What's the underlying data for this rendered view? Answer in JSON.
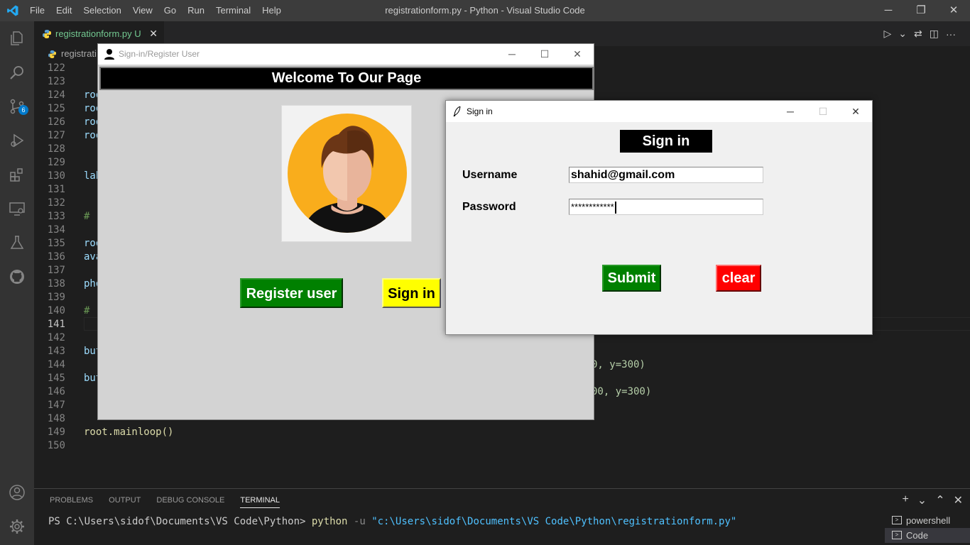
{
  "vscode": {
    "window_title": "registrationform.py - Python - Visual Studio Code",
    "menu": [
      "File",
      "Edit",
      "Selection",
      "View",
      "Go",
      "Run",
      "Terminal",
      "Help"
    ],
    "window_controls": {
      "minimize": "─",
      "restore": "❐",
      "close": "✕"
    },
    "activity_bar": {
      "source_control_badge": "6",
      "icons": [
        "explorer-icon",
        "search-icon",
        "source-control-icon",
        "run-debug-icon",
        "extensions-icon",
        "remote-explorer-icon",
        "testing-icon",
        "github-icon",
        "account-icon",
        "settings-gear-icon"
      ]
    },
    "tab": {
      "label": "registrationform.py",
      "status": "U",
      "close": "✕"
    },
    "breadcrumb": "registrati",
    "editor_actions": {
      "run": "▷",
      "run_menu": "⌄",
      "compare": "⇄",
      "split": "◫",
      "more": "···"
    },
    "code_lines": [
      {
        "n": "122",
        "t": ""
      },
      {
        "n": "123",
        "t": ""
      },
      {
        "n": "124",
        "t": "roo"
      },
      {
        "n": "125",
        "t": "roo"
      },
      {
        "n": "126",
        "t": "roo"
      },
      {
        "n": "127",
        "t": "roo"
      },
      {
        "n": "128",
        "t": ""
      },
      {
        "n": "129",
        "t": ""
      },
      {
        "n": "130",
        "t": "lab"
      },
      {
        "n": "131",
        "t": ""
      },
      {
        "n": "132",
        "t": ""
      },
      {
        "n": "133",
        "t": "# "
      },
      {
        "n": "134",
        "t": ""
      },
      {
        "n": "135",
        "t": "roo"
      },
      {
        "n": "136",
        "t": "ava"
      },
      {
        "n": "137",
        "t": ""
      },
      {
        "n": "138",
        "t": "pho"
      },
      {
        "n": "139",
        "t": ""
      },
      {
        "n": "140",
        "t": "# "
      },
      {
        "n": "141",
        "t": ""
      },
      {
        "n": "142",
        "t": ""
      },
      {
        "n": "143",
        "t": "but"
      },
      {
        "n": "144",
        "t": ""
      },
      {
        "n": "145",
        "t": "but"
      },
      {
        "n": "146",
        "t": ""
      },
      {
        "n": "147",
        "t": ""
      },
      {
        "n": "148",
        "t": ""
      },
      {
        "n": "149",
        "t": "root.mainloop()"
      },
      {
        "n": "150",
        "t": ""
      }
    ],
    "active_line": "141",
    "visible_code_fragments": {
      "line144": "0, y=300)",
      "line146": "00, y=300)"
    },
    "panel": {
      "tabs": [
        "PROBLEMS",
        "OUTPUT",
        "DEBUG CONSOLE",
        "TERMINAL"
      ],
      "active_tab": "TERMINAL",
      "actions": {
        "add": "+",
        "dropdown": "⌄",
        "maximize": "⌃",
        "close": "✕"
      },
      "terminal_prompt": "PS C:\\Users\\sidof\\Documents\\VS Code\\Python>",
      "terminal_command": "python",
      "terminal_flag": "-u",
      "terminal_arg": "\"c:\\Users\\sidof\\Documents\\VS Code\\Python\\registrationform.py\"",
      "terminals": [
        "powershell",
        "Code"
      ]
    }
  },
  "register_window": {
    "title": "Sign-in/Register User",
    "controls": {
      "minimize": "─",
      "maximize": "☐",
      "close": "✕"
    },
    "heading": "Welcome To Our Page",
    "register_button": "Register user",
    "signin_button": "Sign in",
    "colors": {
      "register": "#008000",
      "signin": "#ffff00",
      "background": "#d3d3d3"
    }
  },
  "signin_window": {
    "title": "Sign in",
    "controls": {
      "minimize": "─",
      "maximize": "☐",
      "close": "✕"
    },
    "heading": "Sign in",
    "username_label": "Username",
    "username_value": "shahid@gmail.com",
    "password_label": "Password",
    "password_value": "************",
    "submit_button": "Submit",
    "clear_button": "clear",
    "colors": {
      "submit": "#008000",
      "clear": "#ff0000"
    }
  }
}
